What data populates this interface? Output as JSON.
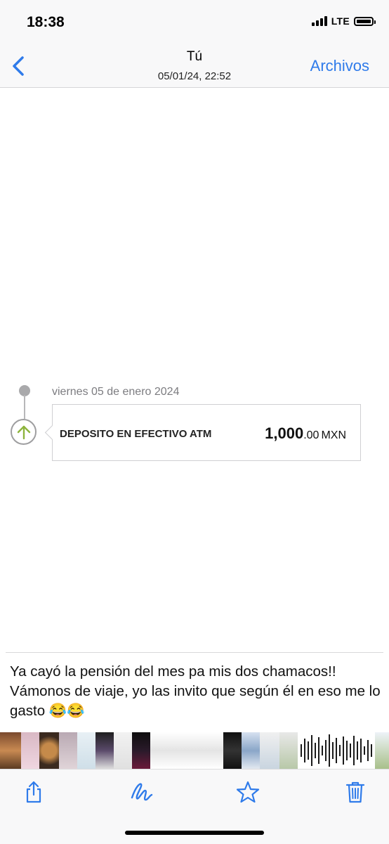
{
  "status_bar": {
    "time": "18:38",
    "network": "LTE"
  },
  "nav": {
    "back_icon": "chevron-left-icon",
    "title": "Tú",
    "subtitle": "05/01/24, 22:52",
    "archive_label": "Archivos"
  },
  "receipt": {
    "date": "viernes 05 de enero  2024",
    "description": "DEPOSITO EN EFECTIVO ATM",
    "amount_integer": "1,000",
    "amount_decimal": ".00",
    "currency": "MXN",
    "icon": "arrow-up-icon"
  },
  "caption": "Ya cayó la pensión del mes pa mis dos chamacos!! Vámonos de viaje, yo las invito que según él en eso me lo gasto 😂😂",
  "toolbar": {
    "share_icon": "share-icon",
    "markup_icon": "markup-icon",
    "favorite_icon": "star-icon",
    "delete_icon": "trash-icon"
  },
  "colors": {
    "accent": "#2f7bea",
    "deposit_arrow": "#8db43c",
    "timeline": "#a9a9ab"
  }
}
